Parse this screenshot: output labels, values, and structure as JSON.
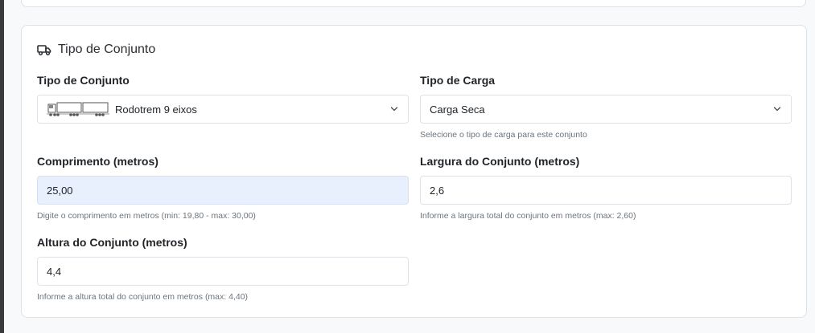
{
  "section": {
    "title": "Tipo de Conjunto",
    "icon": "truck-icon"
  },
  "fields": {
    "tipo_conjunto": {
      "label": "Tipo de Conjunto",
      "value": "Rodotrem 9 eixos",
      "icon": "rodotrem-vehicle-thumbnail"
    },
    "tipo_carga": {
      "label": "Tipo de Carga",
      "value": "Carga Seca",
      "help": "Selecione o tipo de carga para este conjunto"
    },
    "comprimento": {
      "label": "Comprimento (metros)",
      "value": "25,00",
      "help": "Digite o comprimento em metros (min: 19,80 - max: 30,00)"
    },
    "largura": {
      "label": "Largura do Conjunto (metros)",
      "value": "2,6",
      "help": "Informe a largura total do conjunto em metros (max: 2,60)"
    },
    "altura": {
      "label": "Altura do Conjunto (metros)",
      "value": "4,4",
      "help": "Informe a altura total do conjunto em metros (max: 4,40)"
    }
  },
  "colors": {
    "page_background": "#f8f9fb",
    "card_border": "#dee2e6",
    "filled_input_background": "#e8f0fe",
    "help_text": "#6c757d"
  }
}
